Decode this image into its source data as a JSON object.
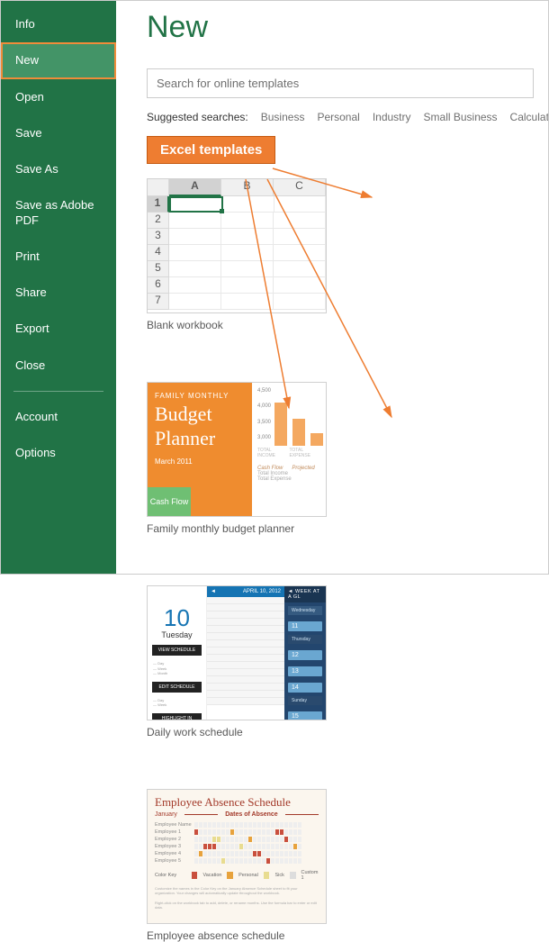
{
  "sidebar": {
    "items": [
      {
        "label": "Info"
      },
      {
        "label": "New"
      },
      {
        "label": "Open"
      },
      {
        "label": "Save"
      },
      {
        "label": "Save As"
      },
      {
        "label": "Save as Adobe PDF"
      },
      {
        "label": "Print"
      },
      {
        "label": "Share"
      },
      {
        "label": "Export"
      },
      {
        "label": "Close"
      }
    ],
    "footer": [
      {
        "label": "Account"
      },
      {
        "label": "Options"
      }
    ],
    "selected_index": 1
  },
  "page_title": "New",
  "search_placeholder": "Search for online templates",
  "suggested_label": "Suggested searches:",
  "suggested": [
    "Business",
    "Personal",
    "Industry",
    "Small Business",
    "Calculator"
  ],
  "annotation_badge": "Excel templates",
  "templates": [
    {
      "caption": "Blank workbook"
    },
    {
      "caption": "Family monthly budget planner"
    },
    {
      "caption": "Daily work schedule"
    },
    {
      "caption": "Employee absence schedule"
    }
  ],
  "blank": {
    "cols": [
      "A",
      "B",
      "C"
    ],
    "rows": [
      "1",
      "2",
      "3",
      "4",
      "5",
      "6",
      "7"
    ]
  },
  "budget": {
    "overline": "FAMILY MONTHLY",
    "title1": "Budget",
    "title2": "Planner",
    "date": "March 2011",
    "cash": "Cash Flow",
    "axis": [
      "4,500",
      "4,000",
      "3,500",
      "3,000"
    ],
    "bars": [
      48,
      30,
      14
    ],
    "bottom_labels": [
      "TOTAL INCOME",
      "TOTAL EXPENSE"
    ],
    "table_head": [
      "Cash Flow",
      "Projected"
    ],
    "table_rows": [
      "Total Income",
      "Total Expense"
    ]
  },
  "daily": {
    "date_num": "10",
    "date_day": "Tuesday",
    "top_left_btn": "VIEW SCHEDULE",
    "top_left_btn2": "EDIT SCHEDULE",
    "top_left_btn3": "HIGHLIGHT IN SCHEDULE",
    "mid_head_left": "◄",
    "mid_head_right": "APRIL 10, 2012",
    "right_head": "◄   WEEK AT A GL",
    "right_day": "Wednesday",
    "right_nums": [
      "11",
      "12",
      "13",
      "14",
      "15"
    ]
  },
  "absence": {
    "title": "Employee Absence Schedule",
    "month": "January",
    "dates_label": "Dates of Absence",
    "employees": [
      "Employee Name",
      "Employee 1",
      "Employee 2",
      "Employee 3",
      "Employee 4",
      "Employee 5"
    ],
    "key_label": "Color Key",
    "keys": [
      "Vacation",
      "Personal",
      "Sick",
      "Custom 1"
    ]
  }
}
